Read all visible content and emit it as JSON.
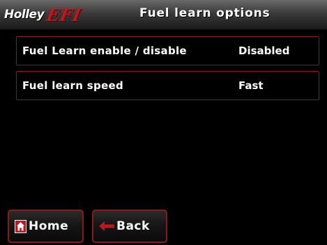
{
  "header": {
    "logo_brand": "Holley",
    "logo_efi": "EFI",
    "title": "Fuel learn options"
  },
  "options": [
    {
      "label": "Fuel Learn enable / disable",
      "value": "Disabled"
    },
    {
      "label": "Fuel learn speed",
      "value": "Fast"
    }
  ],
  "nav": {
    "home_label": "Home",
    "back_label": "Back",
    "home_icon": "home-icon",
    "back_icon": "arrow-left-icon"
  },
  "colors": {
    "accent_red": "#c0171b",
    "border_red": "#8a1a1a",
    "background": "#000000",
    "text": "#ffffff"
  }
}
